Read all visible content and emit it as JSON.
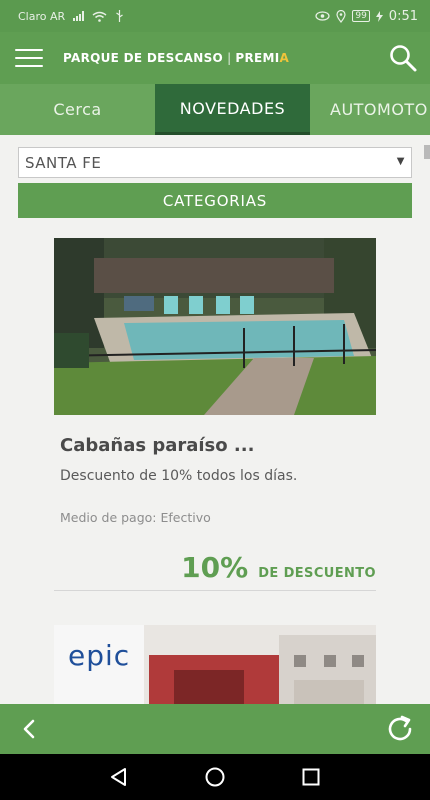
{
  "status_bar": {
    "carrier": "Claro AR",
    "battery": "99",
    "time": "0:51"
  },
  "app_bar": {
    "title": "PARQUE DE DESCANSO",
    "brand_prefix": "PREMI",
    "brand_suffix": "A",
    "search_icon": "search-icon",
    "menu_icon": "hamburger-menu-icon"
  },
  "tabs": [
    {
      "label": "Cerca",
      "active": false
    },
    {
      "label": "NOVEDADES",
      "active": true
    },
    {
      "label": "AUTOMOTO",
      "active": false
    }
  ],
  "filters": {
    "province": "SANTA FE",
    "categories_label": "CATEGORIAS"
  },
  "cards": [
    {
      "title": "Cabañas paraíso ...",
      "description": "Descuento de 10% todos los días.",
      "payment": "Medio de pago: Efectivo",
      "discount_value": "10%",
      "discount_label": "DE DESCUENTO"
    },
    {
      "logo_text": "epic"
    }
  ],
  "bottom_bar": {
    "back_icon": "back-chevron-icon",
    "refresh_icon": "refresh-icon"
  },
  "nav_bar": {
    "back_icon": "nav-back-icon",
    "home_icon": "nav-home-icon",
    "recent_icon": "nav-recent-apps-icon"
  },
  "colors": {
    "primary": "#5f9e52",
    "tab_active": "#2f6a3a",
    "accent": "#f0c43a"
  }
}
